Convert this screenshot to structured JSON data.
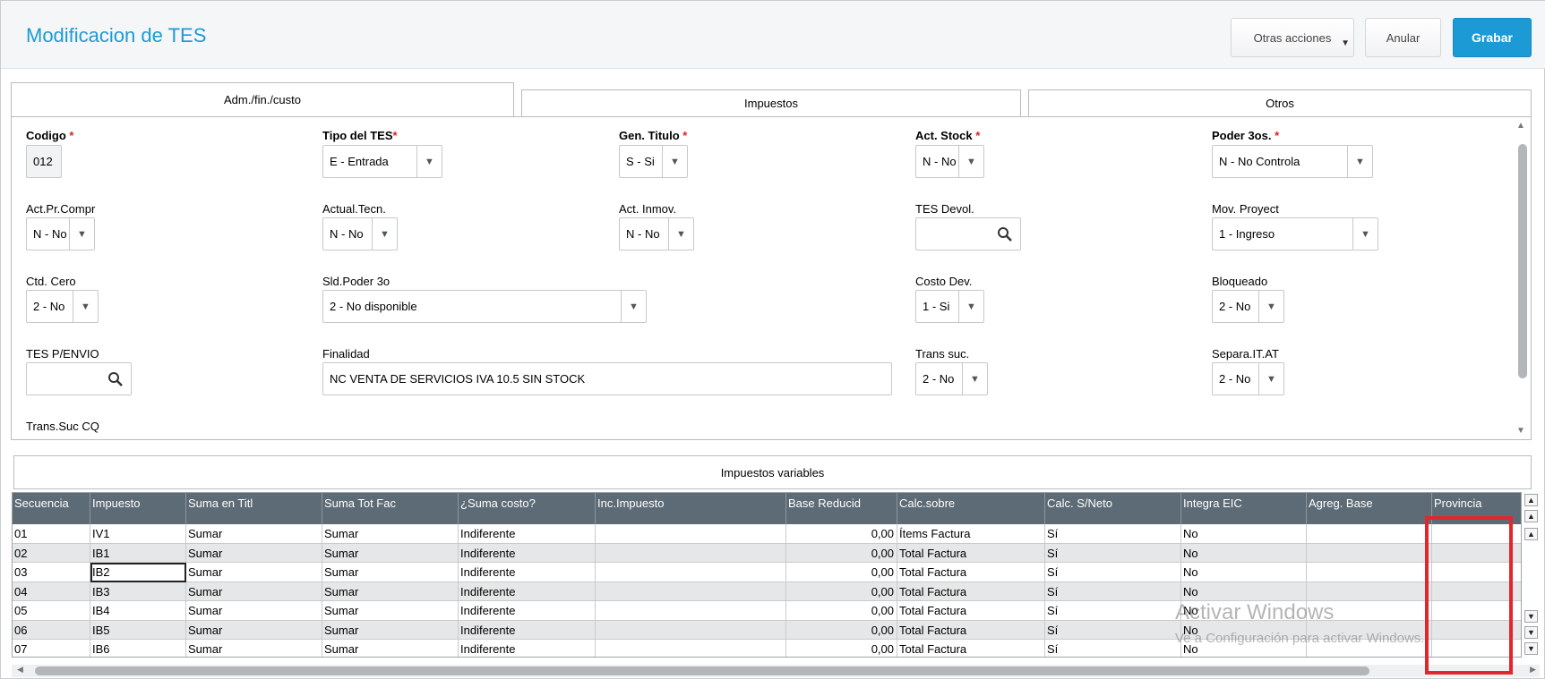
{
  "header": {
    "title": "Modificacion de TES",
    "buttons": {
      "otras": "Otras acciones",
      "anular": "Anular",
      "grabar": "Grabar"
    }
  },
  "tabs": [
    {
      "label": "Adm./fin./custo",
      "active": true
    },
    {
      "label": "Impuestos",
      "active": false
    },
    {
      "label": "Otros",
      "active": false
    }
  ],
  "form": {
    "codigo": {
      "label": "Codigo",
      "required": "*",
      "value": "012"
    },
    "tipo_tes": {
      "label": "Tipo del TES",
      "required": "*",
      "value": "E - Entrada"
    },
    "gen_titulo": {
      "label": "Gen. Titulo",
      "required": "*",
      "value": "S - Si"
    },
    "act_stock": {
      "label": "Act. Stock",
      "required": "*",
      "value": "N - No"
    },
    "poder_3os": {
      "label": "Poder 3os.",
      "required": "*",
      "value": "N - No Controla"
    },
    "act_pr_compr": {
      "label": "Act.Pr.Compr",
      "value": "N - No"
    },
    "actual_tecn": {
      "label": "Actual.Tecn.",
      "value": "N - No"
    },
    "act_inmov": {
      "label": "Act. Inmov.",
      "value": "N - No"
    },
    "tes_devol": {
      "label": "TES Devol.",
      "value": ""
    },
    "mov_proyect": {
      "label": "Mov. Proyect",
      "value": "1 - Ingreso"
    },
    "ctd_cero": {
      "label": "Ctd. Cero",
      "value": "2 - No"
    },
    "sld_poder_3o": {
      "label": "Sld.Poder 3o",
      "value": "2 - No disponible"
    },
    "costo_dev": {
      "label": "Costo Dev.",
      "value": "1 - Si"
    },
    "bloqueado": {
      "label": "Bloqueado",
      "value": "2 - No"
    },
    "tes_p_envio": {
      "label": "TES P/ENVIO",
      "value": ""
    },
    "finalidad": {
      "label": "Finalidad",
      "value": "NC VENTA DE SERVICIOS IVA 10.5 SIN STOCK"
    },
    "trans_suc": {
      "label": "Trans suc.",
      "value": "2 - No"
    },
    "separa_it_at": {
      "label": "Separa.IT.AT",
      "value": "2 - No"
    },
    "trans_suc_cq": {
      "label": "Trans.Suc CQ"
    }
  },
  "grid": {
    "title": "Impuestos variables",
    "columns": [
      "Secuencia",
      "Impuesto",
      "Suma en Titl",
      "Suma Tot Fac",
      "¿Suma costo?",
      "Inc.Impuesto",
      "Base Reducid",
      "Calc.sobre",
      "Calc. S/Neto",
      "Integra EIC",
      "Agreg. Base",
      "Provincia"
    ],
    "rows": [
      [
        "01",
        "IV1",
        "Sumar",
        "Sumar",
        "Indiferente",
        "",
        "0,00",
        "Ítems Factura",
        "Sí",
        "No",
        "",
        ""
      ],
      [
        "02",
        "IB1",
        "Sumar",
        "Sumar",
        "Indiferente",
        "",
        "0,00",
        "Total Factura",
        "Sí",
        "No",
        "",
        ""
      ],
      [
        "03",
        "IB2",
        "Sumar",
        "Sumar",
        "Indiferente",
        "",
        "0,00",
        "Total Factura",
        "Sí",
        "No",
        "",
        ""
      ],
      [
        "04",
        "IB3",
        "Sumar",
        "Sumar",
        "Indiferente",
        "",
        "0,00",
        "Total Factura",
        "Sí",
        "No",
        "",
        ""
      ],
      [
        "05",
        "IB4",
        "Sumar",
        "Sumar",
        "Indiferente",
        "",
        "0,00",
        "Total Factura",
        "Sí",
        "No",
        "",
        ""
      ],
      [
        "06",
        "IB5",
        "Sumar",
        "Sumar",
        "Indiferente",
        "",
        "0,00",
        "Total Factura",
        "Sí",
        "No",
        "",
        ""
      ],
      [
        "07",
        "IB6",
        "Sumar",
        "Sumar",
        "Indiferente",
        "",
        "0,00",
        "Total Factura",
        "Sí",
        "No",
        "",
        ""
      ]
    ]
  },
  "watermark": {
    "line1": "Activar Windows",
    "line2": "Ve a Configuración para activar Windows."
  },
  "colors": {
    "accent": "#1c9ad6",
    "grid_header": "#5d6b76",
    "highlight": "#e3262b",
    "required": "#e02020"
  }
}
